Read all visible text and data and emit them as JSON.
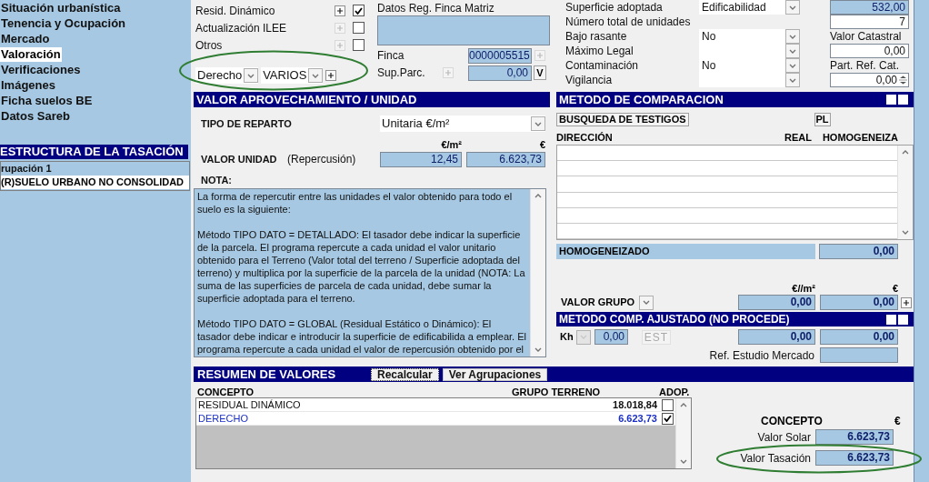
{
  "sidebar": {
    "nav_items": [
      {
        "label": "Situación urbanística",
        "selected": false
      },
      {
        "label": "Tenencia y Ocupación",
        "selected": false
      },
      {
        "label": "Mercado",
        "selected": false
      },
      {
        "label": "Valoración",
        "selected": true
      },
      {
        "label": "Verificaciones",
        "selected": false
      },
      {
        "label": "Imágenes",
        "selected": false
      },
      {
        "label": "Ficha suelos BE",
        "selected": false
      },
      {
        "label": "Datos Sareb",
        "selected": false
      }
    ],
    "structure": {
      "title": "ESTRUCTURA DE LA TASACIÓN",
      "tree": [
        {
          "label": "rupación 1",
          "selected": false,
          "children": [
            {
              "label": "(R)SUELO URBANO NO CONSOLIDAD",
              "selected": true
            }
          ]
        }
      ]
    }
  },
  "methods": [
    {
      "label": "Resid. Dinámico",
      "checked": true,
      "add_disabled": false
    },
    {
      "label": "Actualización ILEE",
      "checked": false,
      "add_disabled": true
    },
    {
      "label": "Otros",
      "checked": false,
      "add_disabled": true
    }
  ],
  "selectors": [
    {
      "value": "Derecho"
    },
    {
      "value": "VARIOS"
    }
  ],
  "finca_matriz": {
    "title": "Datos Reg. Finca Matriz",
    "finca": {
      "label": "Finca",
      "value": "0000005515"
    },
    "sup_parc": {
      "label": "Sup.Parc.",
      "value": "0,00",
      "button": "V"
    }
  },
  "properties": [
    {
      "label": "Superficie adoptada",
      "has_select": true,
      "select_value": "Edificabilidad",
      "side": {
        "kind": "field",
        "value": "532,00",
        "shaded": true
      }
    },
    {
      "label": "Número total de unidades",
      "has_select": false,
      "side": {
        "kind": "field",
        "value": "7",
        "shaded": false
      }
    },
    {
      "label": "Bajo rasante",
      "has_select": true,
      "select_value": "No",
      "side": {
        "kind": "label",
        "text": "Valor Catastral"
      }
    },
    {
      "label": "Máximo Legal",
      "has_select": true,
      "side": {
        "kind": "field",
        "value": "0,00",
        "shaded": false
      }
    },
    {
      "label": "Contaminación",
      "has_select": true,
      "select_value": "No",
      "side": {
        "kind": "label",
        "text": "Part. Ref. Cat."
      }
    },
    {
      "label": "Vigilancia",
      "has_select": true,
      "side": {
        "kind": "spinner",
        "value": "0,00"
      }
    }
  ],
  "aprovechamiento": {
    "title": "VALOR APROVECHAMIENTO / UNIDAD",
    "tipo_label": "TIPO DE REPARTO",
    "tipo_value": "Unitaria €/m²",
    "unit_headers": [
      "€/m²",
      "€"
    ],
    "valor_label": "VALOR UNIDAD",
    "valor_sublabel": "(Repercusión)",
    "values": [
      "12,45",
      "6.623,73"
    ],
    "nota_label": "NOTA:",
    "nota_paragraphs": [
      "La forma de repercutir entre las unidades el valor obtenido para todo el suelo es la siguiente:",
      "Método TIPO DATO = DETALLADO: El tasador debe indicar la superficie de la parcela. El programa repercute a cada unidad el valor unitario obtenido para el Terreno (Valor total del terreno / Superficie adoptada del terreno) y multiplica por la superficie de la parcela de la unidad (NOTA: La suma de las superficies de parcela de cada unidad, debe sumar la superficie adoptada para el terreno.",
      "Método TIPO DATO = GLOBAL (Residual Estático o Dinámico): El tasador debe indicar e introducir la superficie de edificabilida a emplear. El programa repercute a cada unidad el valor de repercusión obtenido por el"
    ]
  },
  "comparacion": {
    "title": "METODO DE COMPARACION",
    "search_button": "BUSQUEDA DE TESTIGOS",
    "pl_button": "PL",
    "columns": [
      "DIRECCIÓN",
      "REAL",
      "HOMOGENEIZA"
    ],
    "homogeneizado_label": "HOMOGENEIZADO",
    "homogeneizado_value": "0,00",
    "group_headers": [
      "€//m²",
      "€"
    ],
    "grupo_label": "VALOR GRUPO",
    "grupo_values": [
      "0,00",
      "0,00"
    ],
    "ajustado": {
      "title": "METODO COMP. AJUSTADO (NO PROCEDE)",
      "kh_label": "Kh",
      "kh_value": "0,00",
      "est_button": "EST",
      "est_disabled": true,
      "values": [
        "0,00",
        "0,00"
      ],
      "ref_label": "Ref. Estudio Mercado"
    }
  },
  "resumen": {
    "title": "RESUMEN DE VALORES",
    "buttons": [
      {
        "label": "Recalcular",
        "focused": true
      },
      {
        "label": "Ver Agrupaciones",
        "focused": false
      }
    ],
    "columns": [
      "CONCEPTO",
      "GRUPO TERRENO",
      "ADOP."
    ],
    "rows": [
      {
        "concept": "RESIDUAL DINÁMICO",
        "value": "18.018,84",
        "adopted": false
      },
      {
        "concept": "DERECHO",
        "value": "6.623,73",
        "adopted": true
      }
    ],
    "summary_headers": [
      "CONCEPTO",
      "€"
    ],
    "summary": [
      {
        "label": "Valor Solar",
        "value": "6.623,73"
      },
      {
        "label": "Valor Tasación",
        "value": "6.623,73"
      }
    ]
  }
}
